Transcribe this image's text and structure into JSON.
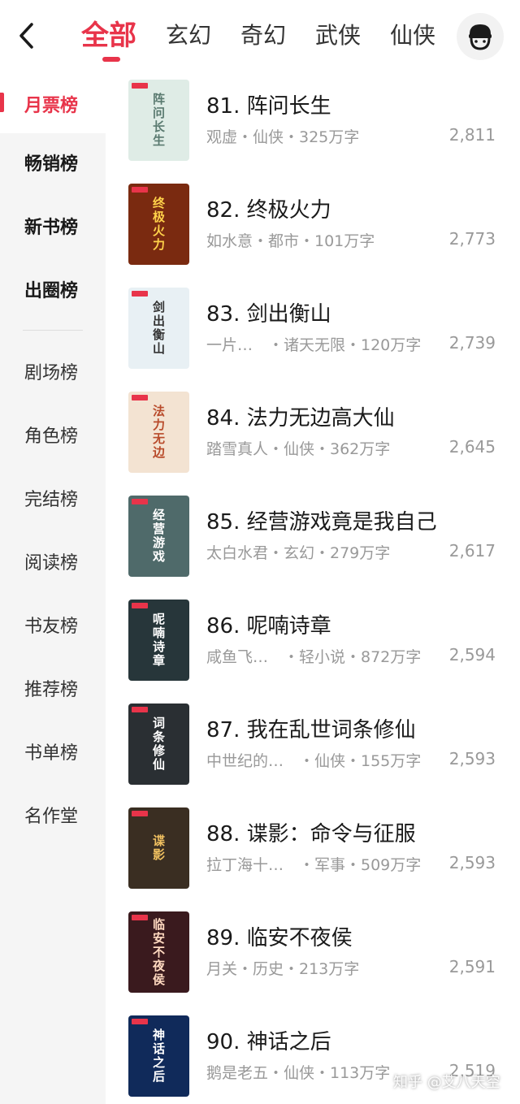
{
  "header": {
    "tabs": [
      "全部",
      "玄幻",
      "奇幻",
      "武侠",
      "仙侠"
    ],
    "active_tab": 0
  },
  "sidebar": {
    "items": [
      {
        "label": "月票榜",
        "style": "active"
      },
      {
        "label": "畅销榜",
        "style": "bold"
      },
      {
        "label": "新书榜",
        "style": "bold"
      },
      {
        "label": "出圈榜",
        "style": "bold"
      },
      {
        "label": "剧场榜",
        "style": "normal"
      },
      {
        "label": "角色榜",
        "style": "normal"
      },
      {
        "label": "完结榜",
        "style": "normal"
      },
      {
        "label": "阅读榜",
        "style": "normal"
      },
      {
        "label": "书友榜",
        "style": "normal"
      },
      {
        "label": "推荐榜",
        "style": "normal"
      },
      {
        "label": "书单榜",
        "style": "normal"
      },
      {
        "label": "名作堂",
        "style": "normal"
      }
    ]
  },
  "books": [
    {
      "title": "81. 阵问长生",
      "meta": "观虚・仙侠・325万字",
      "count": "2,811",
      "cover_text": "阵问长生",
      "cover_bg": "#dfece6",
      "cover_fg": "#5a7a70"
    },
    {
      "title": "82. 终极火力",
      "meta": "如水意・都市・101万字",
      "count": "2,773",
      "cover_text": "终极火力",
      "cover_bg": "#7a2a10",
      "cover_fg": "#ffd24a"
    },
    {
      "title": "83. 剑出衡山",
      "meta": "一片…　・诸天无限・120万字",
      "count": "2,739",
      "cover_text": "剑出衡山",
      "cover_bg": "#e8f0f4",
      "cover_fg": "#333333"
    },
    {
      "title": "84. 法力无边高大仙",
      "meta": "踏雪真人・仙侠・362万字",
      "count": "2,645",
      "cover_text": "法力无边",
      "cover_bg": "#f3e3d2",
      "cover_fg": "#b84a2a"
    },
    {
      "title": "85. 经营游戏竟是我自己",
      "meta": "太白水君・玄幻・279万字",
      "count": "2,617",
      "cover_text": "经营游戏",
      "cover_bg": "#4f6a6a",
      "cover_fg": "#ffffff"
    },
    {
      "title": "86. 呢喃诗章",
      "meta": "咸鱼飞…　・轻小说・872万字",
      "count": "2,594",
      "cover_text": "呢喃诗章",
      "cover_bg": "#27363a",
      "cover_fg": "#ffffff"
    },
    {
      "title": "87. 我在乱世词条修仙",
      "meta": "中世纪的…　・仙侠・155万字",
      "count": "2,593",
      "cover_text": "词条修仙",
      "cover_bg": "#2a2f33",
      "cover_fg": "#ffffff"
    },
    {
      "title": "88. 谍影：命令与征服",
      "meta": "拉丁海十…　・军事・509万字",
      "count": "2,593",
      "cover_text": "谍影",
      "cover_bg": "#3a2e22",
      "cover_fg": "#f0c060"
    },
    {
      "title": "89. 临安不夜侯",
      "meta": "月关・历史・213万字",
      "count": "2,591",
      "cover_text": "临安不夜侯",
      "cover_bg": "#3a1a1e",
      "cover_fg": "#ffd9c0"
    },
    {
      "title": "90. 神话之后",
      "meta": "鹅是老五・仙侠・113万字",
      "count": "2,519",
      "cover_text": "神话之后",
      "cover_bg": "#102a5a",
      "cover_fg": "#ffffff"
    }
  ],
  "watermark": "知乎 @艾八天空",
  "colors": {
    "accent": "#e8344a",
    "sidebar_bg": "#f5f5f5",
    "meta_text": "#999999"
  },
  "icons": {
    "back": "chevron-left-icon",
    "avatar": "user-avatar-icon"
  }
}
